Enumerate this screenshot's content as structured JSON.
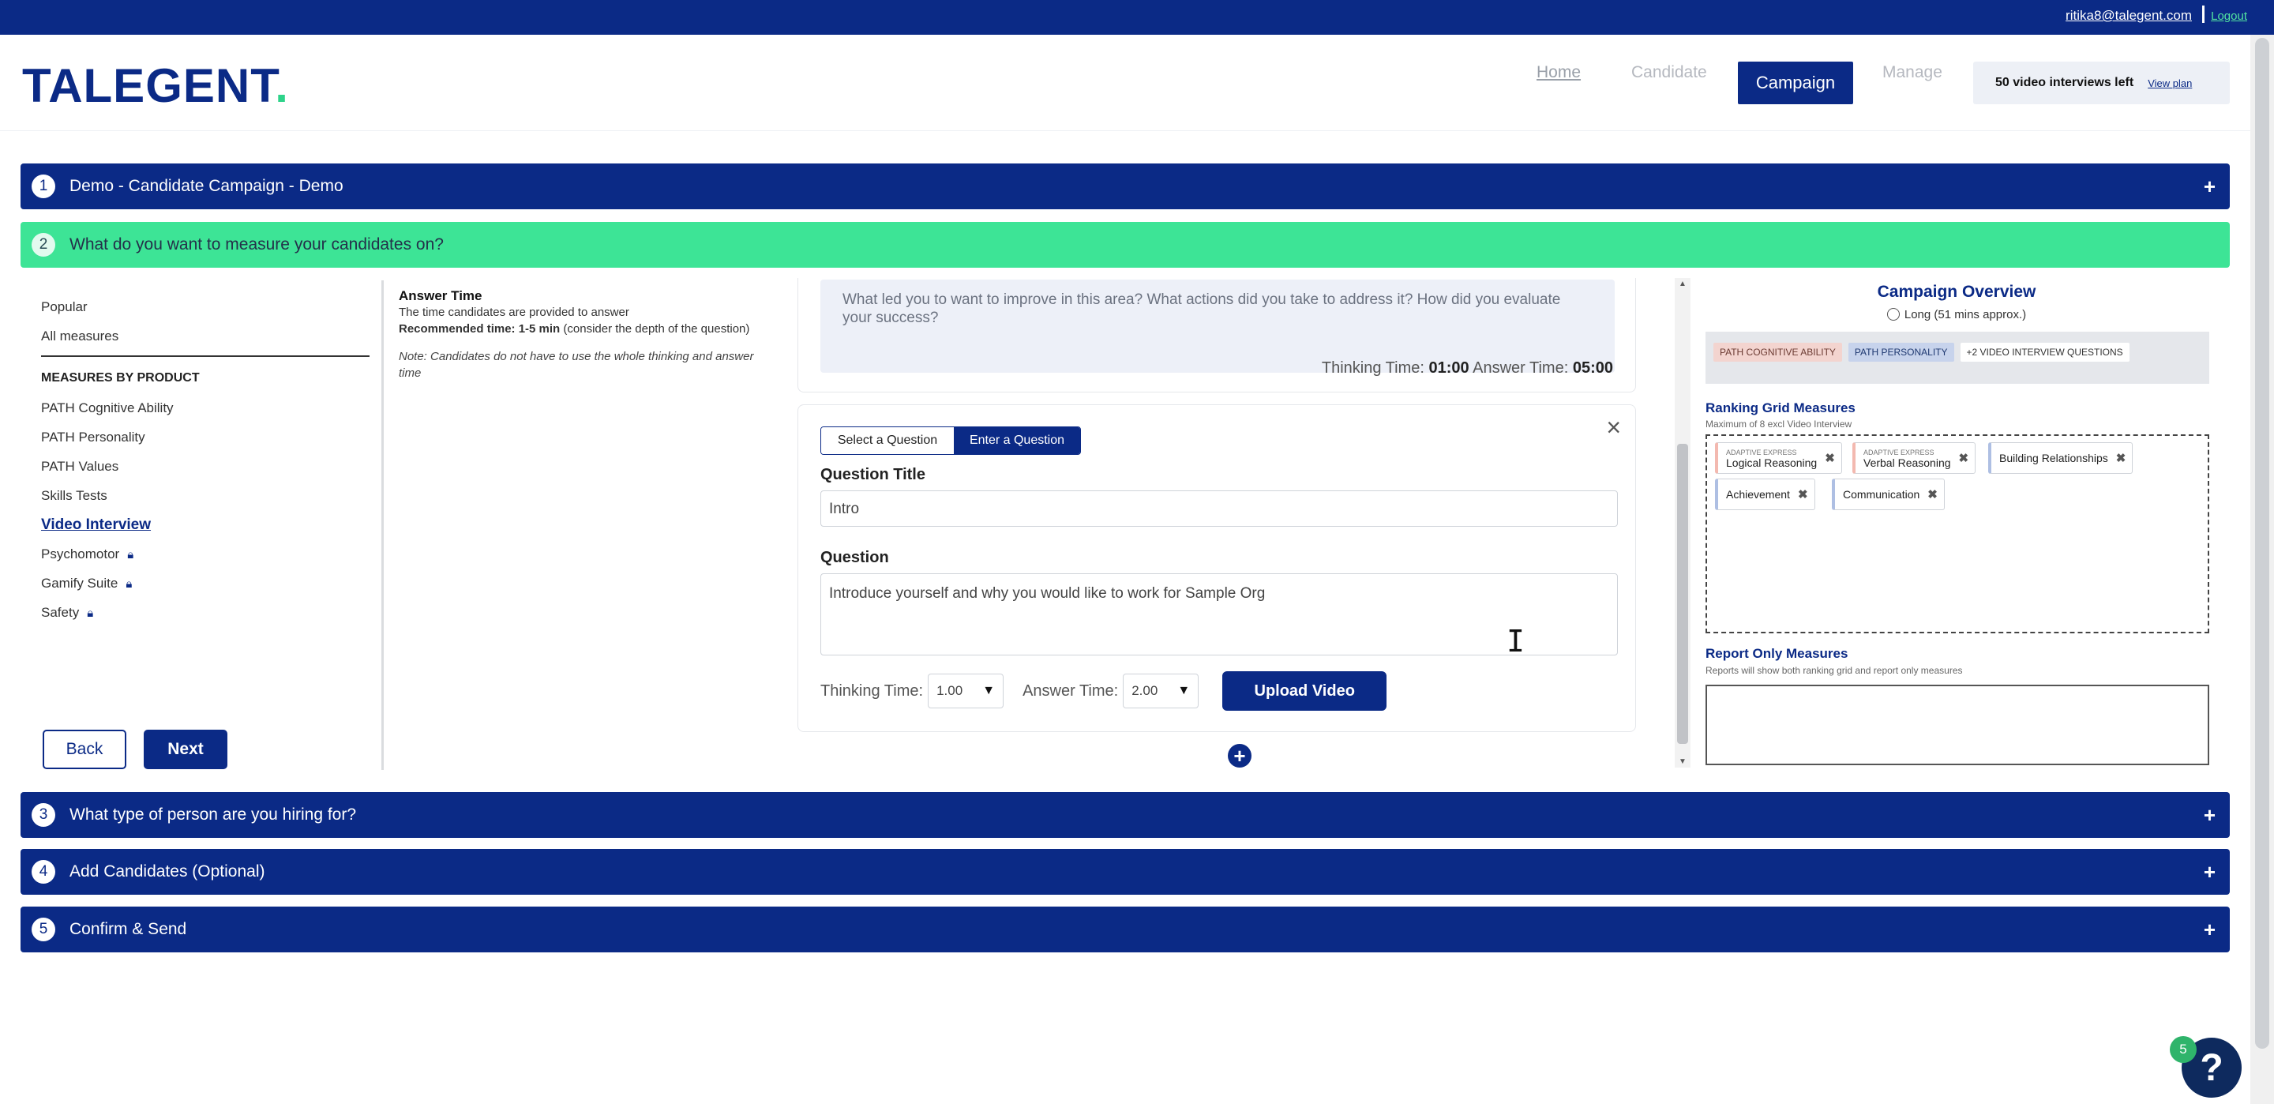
{
  "topbar": {
    "email": "ritika8@talegent.com",
    "logout": "Logout"
  },
  "header": {
    "logo_text": "TALEGENT",
    "logo_dot": ".",
    "nav": {
      "home": "Home",
      "candidate": "Candidate",
      "campaign": "Campaign",
      "manage": "Manage"
    },
    "plan": {
      "remaining": "50 video interviews left",
      "view_plan": "View plan"
    }
  },
  "sections": [
    {
      "num": "1",
      "title": "Demo - Candidate Campaign - Demo",
      "icon": "+"
    },
    {
      "num": "2",
      "title": "What do you want to measure your candidates on?"
    },
    {
      "num": "3",
      "title": "What type of person are you hiring for?",
      "icon": "+"
    },
    {
      "num": "4",
      "title": "Add Candidates (Optional)",
      "icon": "+"
    },
    {
      "num": "5",
      "title": "Confirm & Send",
      "icon": "+"
    }
  ],
  "left_panel": {
    "popular": "Popular",
    "all_measures": "All measures",
    "heading": "MEASURES BY PRODUCT",
    "items": [
      "PATH Cognitive Ability",
      "PATH Personality",
      "PATH Values",
      "Skills Tests",
      "Video Interview",
      "Psychomotor",
      "Gamify Suite",
      "Safety"
    ],
    "back": "Back",
    "next": "Next"
  },
  "info": {
    "title": "Answer Time",
    "line1": "The time candidates are provided to answer",
    "recommended_label": "Recommended time: 1-5 min",
    "recommended_rest": " (consider the depth of the question)",
    "note": "Note: Candidates do not have to use the whole thinking and answer time"
  },
  "prev_question": {
    "text": "What led you to want to improve in this area? What actions did you take to address it? How did you evaluate your success?",
    "thinking_label": "Thinking Time:",
    "thinking_value": "01:00",
    "answer_label": "Answer Time:",
    "answer_value": "05:00"
  },
  "editor": {
    "tab_select": "Select a Question",
    "tab_enter": "Enter a Question",
    "title_label": "Question Title",
    "title_value": "Intro",
    "question_label": "Question",
    "question_value": "Introduce yourself and why you would like to work for Sample Org",
    "thinking_label": "Thinking Time:",
    "thinking_value": "1.00",
    "answer_label": "Answer Time:",
    "answer_value": "2.00",
    "upload": "Upload Video",
    "close": "×",
    "add": "+"
  },
  "overview": {
    "title": "Campaign Overview",
    "duration": "Long (51 mins approx.)",
    "chips": [
      "PATH COGNITIVE ABILITY",
      "PATH PERSONALITY",
      "+2 VIDEO INTERVIEW QUESTIONS"
    ],
    "ranking_title": "Ranking Grid Measures",
    "ranking_sub": "Maximum of 8 excl Video Interview",
    "tags": [
      {
        "small": "ADAPTIVE EXPRESS",
        "label": "Logical Reasoning"
      },
      {
        "small": "ADAPTIVE EXPRESS",
        "label": "Verbal Reasoning"
      },
      {
        "small": "",
        "label": "Building Relationships"
      },
      {
        "small": "",
        "label": "Achievement"
      },
      {
        "small": "",
        "label": "Communication"
      }
    ],
    "report_title": "Report Only Measures",
    "report_sub": "Reports will show both ranking grid and report only measures"
  },
  "help": {
    "badge": "5",
    "icon": "?"
  },
  "colors": {
    "navy": "#0b2a86",
    "green": "#3de496"
  }
}
